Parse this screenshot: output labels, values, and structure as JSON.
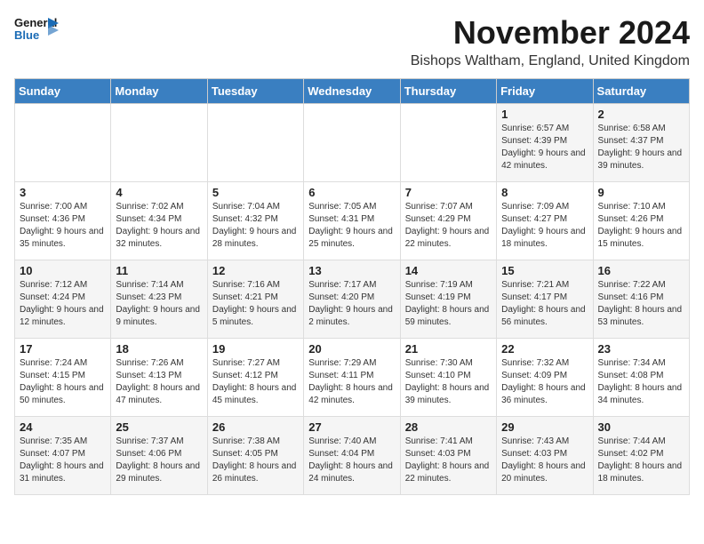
{
  "logo": {
    "general": "General",
    "blue": "Blue"
  },
  "title": "November 2024",
  "location": "Bishops Waltham, England, United Kingdom",
  "days_of_week": [
    "Sunday",
    "Monday",
    "Tuesday",
    "Wednesday",
    "Thursday",
    "Friday",
    "Saturday"
  ],
  "weeks": [
    [
      {
        "day": "",
        "info": ""
      },
      {
        "day": "",
        "info": ""
      },
      {
        "day": "",
        "info": ""
      },
      {
        "day": "",
        "info": ""
      },
      {
        "day": "",
        "info": ""
      },
      {
        "day": "1",
        "info": "Sunrise: 6:57 AM\nSunset: 4:39 PM\nDaylight: 9 hours and 42 minutes."
      },
      {
        "day": "2",
        "info": "Sunrise: 6:58 AM\nSunset: 4:37 PM\nDaylight: 9 hours and 39 minutes."
      }
    ],
    [
      {
        "day": "3",
        "info": "Sunrise: 7:00 AM\nSunset: 4:36 PM\nDaylight: 9 hours and 35 minutes."
      },
      {
        "day": "4",
        "info": "Sunrise: 7:02 AM\nSunset: 4:34 PM\nDaylight: 9 hours and 32 minutes."
      },
      {
        "day": "5",
        "info": "Sunrise: 7:04 AM\nSunset: 4:32 PM\nDaylight: 9 hours and 28 minutes."
      },
      {
        "day": "6",
        "info": "Sunrise: 7:05 AM\nSunset: 4:31 PM\nDaylight: 9 hours and 25 minutes."
      },
      {
        "day": "7",
        "info": "Sunrise: 7:07 AM\nSunset: 4:29 PM\nDaylight: 9 hours and 22 minutes."
      },
      {
        "day": "8",
        "info": "Sunrise: 7:09 AM\nSunset: 4:27 PM\nDaylight: 9 hours and 18 minutes."
      },
      {
        "day": "9",
        "info": "Sunrise: 7:10 AM\nSunset: 4:26 PM\nDaylight: 9 hours and 15 minutes."
      }
    ],
    [
      {
        "day": "10",
        "info": "Sunrise: 7:12 AM\nSunset: 4:24 PM\nDaylight: 9 hours and 12 minutes."
      },
      {
        "day": "11",
        "info": "Sunrise: 7:14 AM\nSunset: 4:23 PM\nDaylight: 9 hours and 9 minutes."
      },
      {
        "day": "12",
        "info": "Sunrise: 7:16 AM\nSunset: 4:21 PM\nDaylight: 9 hours and 5 minutes."
      },
      {
        "day": "13",
        "info": "Sunrise: 7:17 AM\nSunset: 4:20 PM\nDaylight: 9 hours and 2 minutes."
      },
      {
        "day": "14",
        "info": "Sunrise: 7:19 AM\nSunset: 4:19 PM\nDaylight: 8 hours and 59 minutes."
      },
      {
        "day": "15",
        "info": "Sunrise: 7:21 AM\nSunset: 4:17 PM\nDaylight: 8 hours and 56 minutes."
      },
      {
        "day": "16",
        "info": "Sunrise: 7:22 AM\nSunset: 4:16 PM\nDaylight: 8 hours and 53 minutes."
      }
    ],
    [
      {
        "day": "17",
        "info": "Sunrise: 7:24 AM\nSunset: 4:15 PM\nDaylight: 8 hours and 50 minutes."
      },
      {
        "day": "18",
        "info": "Sunrise: 7:26 AM\nSunset: 4:13 PM\nDaylight: 8 hours and 47 minutes."
      },
      {
        "day": "19",
        "info": "Sunrise: 7:27 AM\nSunset: 4:12 PM\nDaylight: 8 hours and 45 minutes."
      },
      {
        "day": "20",
        "info": "Sunrise: 7:29 AM\nSunset: 4:11 PM\nDaylight: 8 hours and 42 minutes."
      },
      {
        "day": "21",
        "info": "Sunrise: 7:30 AM\nSunset: 4:10 PM\nDaylight: 8 hours and 39 minutes."
      },
      {
        "day": "22",
        "info": "Sunrise: 7:32 AM\nSunset: 4:09 PM\nDaylight: 8 hours and 36 minutes."
      },
      {
        "day": "23",
        "info": "Sunrise: 7:34 AM\nSunset: 4:08 PM\nDaylight: 8 hours and 34 minutes."
      }
    ],
    [
      {
        "day": "24",
        "info": "Sunrise: 7:35 AM\nSunset: 4:07 PM\nDaylight: 8 hours and 31 minutes."
      },
      {
        "day": "25",
        "info": "Sunrise: 7:37 AM\nSunset: 4:06 PM\nDaylight: 8 hours and 29 minutes."
      },
      {
        "day": "26",
        "info": "Sunrise: 7:38 AM\nSunset: 4:05 PM\nDaylight: 8 hours and 26 minutes."
      },
      {
        "day": "27",
        "info": "Sunrise: 7:40 AM\nSunset: 4:04 PM\nDaylight: 8 hours and 24 minutes."
      },
      {
        "day": "28",
        "info": "Sunrise: 7:41 AM\nSunset: 4:03 PM\nDaylight: 8 hours and 22 minutes."
      },
      {
        "day": "29",
        "info": "Sunrise: 7:43 AM\nSunset: 4:03 PM\nDaylight: 8 hours and 20 minutes."
      },
      {
        "day": "30",
        "info": "Sunrise: 7:44 AM\nSunset: 4:02 PM\nDaylight: 8 hours and 18 minutes."
      }
    ]
  ]
}
